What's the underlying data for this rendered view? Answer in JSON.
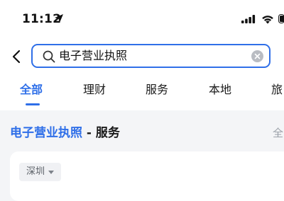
{
  "status_bar": {
    "time": "11:12"
  },
  "search": {
    "query": "电子营业执照"
  },
  "tabs": [
    {
      "label": "全部",
      "active": true
    },
    {
      "label": "理财",
      "active": false
    },
    {
      "label": "服务",
      "active": false
    },
    {
      "label": "本地",
      "active": false
    },
    {
      "label": "旅",
      "active": false
    }
  ],
  "section": {
    "title_highlight": "电子营业执照",
    "title_rest": " - 服务",
    "all_link": "全"
  },
  "filter": {
    "city": "深圳"
  },
  "colors": {
    "accent": "#2f6fe8",
    "background": "#f4f5f7",
    "muted_text": "#9aa0a8"
  },
  "icons": {
    "location": "location-arrow-icon",
    "signal": "cellular-signal-icon",
    "wifi": "wifi-icon",
    "battery": "battery-icon",
    "back": "chevron-left-icon",
    "search": "search-icon",
    "clear": "clear-icon",
    "caret": "caret-down-icon"
  }
}
